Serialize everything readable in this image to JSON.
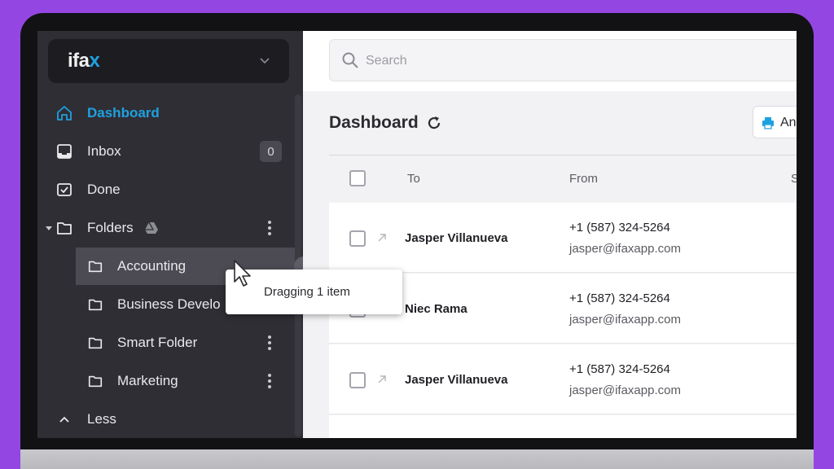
{
  "sidebar": {
    "brand": {
      "text": "ifa",
      "accent": "x"
    },
    "nav": [
      {
        "label": "Dashboard",
        "icon": "home-icon",
        "active": true
      },
      {
        "label": "Inbox",
        "icon": "inbox-icon",
        "badge": "0"
      },
      {
        "label": "Done",
        "icon": "done-icon"
      },
      {
        "label": "Folders",
        "icon": "folder-icon"
      }
    ],
    "folders": [
      {
        "label": "Accounting"
      },
      {
        "label": "Business Develo"
      },
      {
        "label": "Smart Folder"
      },
      {
        "label": "Marketing"
      }
    ],
    "less_label": "Less"
  },
  "search": {
    "placeholder": "Search"
  },
  "main": {
    "title": "Dashboard",
    "action_label": "An",
    "columns": {
      "to": "To",
      "from": "From",
      "partial": "S"
    },
    "rows": [
      {
        "to": "Jasper Villanueva",
        "phone": "+1 (587) 324-5264",
        "email": "jasper@ifaxapp.com"
      },
      {
        "to": "Niec Rama",
        "phone": "+1 (587) 324-5264",
        "email": "jasper@ifaxapp.com"
      },
      {
        "to": "Jasper Villanueva",
        "phone": "+1 (587) 324-5264",
        "email": "jasper@ifaxapp.com"
      }
    ]
  },
  "drag": {
    "label": "Dragging 1 item"
  },
  "colors": {
    "accent": "#1ea1e0",
    "sidebar": "#2f2e35",
    "background": "#9446e2"
  }
}
